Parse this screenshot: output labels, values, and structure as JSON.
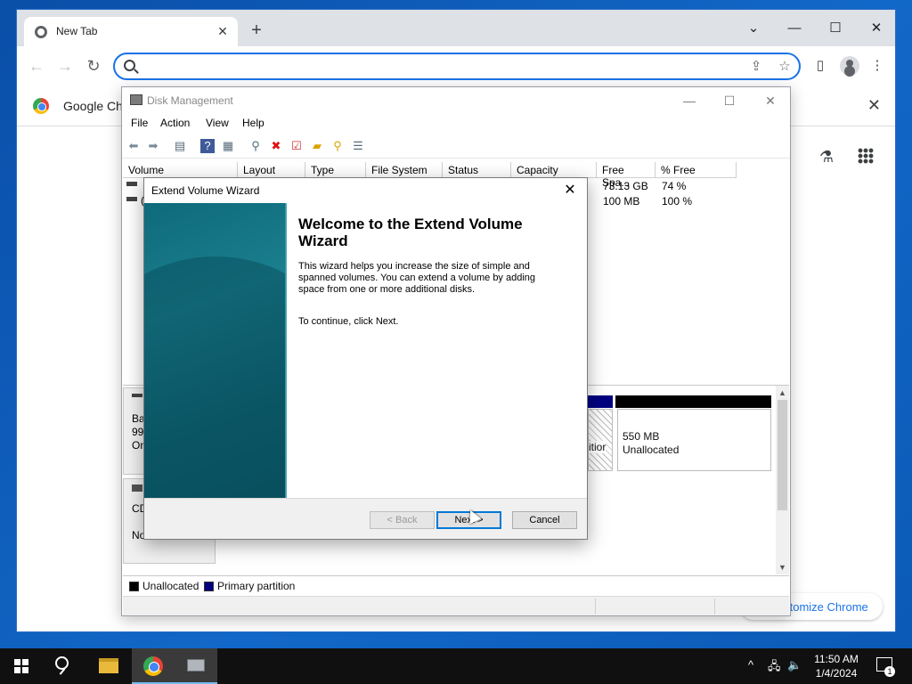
{
  "browser": {
    "tab_title": "New Tab",
    "tab_close": "✕",
    "new_tab": "+",
    "window_controls": {
      "menu": "⌄",
      "minimize": "—",
      "maximize": "☐",
      "close": "✕"
    },
    "nav": {
      "back": "←",
      "forward": "→",
      "reload": "↻"
    },
    "omnibox_placeholder": "",
    "share_icon": "⇪",
    "star_icon": "☆",
    "sidepanel_icon": "▯",
    "menu_icon": "⋮",
    "infobar_text": "Google Chr",
    "infobar_close": "✕",
    "labs_icon": "⚗",
    "customize_label": "ıtomize Chrome"
  },
  "disk_management": {
    "title": "Disk Management",
    "controls": {
      "minimize": "—",
      "maximize": "☐",
      "close": "✕"
    },
    "menu": [
      "File",
      "Action",
      "View",
      "Help"
    ],
    "toolbar_icons": [
      "back-arrow",
      "forward-arrow",
      "console-tree",
      "help",
      "properties",
      "connect",
      "delete",
      "check",
      "folder-up",
      "search",
      "list-view"
    ],
    "columns": [
      "Volume",
      "Layout",
      "Type",
      "File System",
      "Status",
      "Capacity",
      "Free Spa...",
      "% Free"
    ],
    "rows": [
      {
        "volume": "",
        "free_space": "73.13 GB",
        "pct_free": "74 %"
      },
      {
        "volume": "(",
        "free_space": "100 MB",
        "pct_free": "100 %"
      }
    ],
    "disks": [
      {
        "line1": "Ba",
        "line2": "99.",
        "line3": "On"
      },
      {
        "line1": "CD",
        "line2": "",
        "line3": "No"
      }
    ],
    "partitions": [
      {
        "label": "itior"
      },
      {
        "size": "550 MB",
        "status": "Unallocated"
      }
    ],
    "legend": [
      {
        "label": "Unallocated",
        "color": "#000000"
      },
      {
        "label": "Primary partition",
        "color": "#000080"
      }
    ]
  },
  "wizard": {
    "title": "Extend Volume Wizard",
    "close": "✕",
    "heading": "Welcome to the Extend Volume Wizard",
    "description": "This wizard helps you increase the size of simple and spanned volumes. You can extend a volume  by adding space from one or more additional disks.",
    "continue_text": "To continue, click Next.",
    "buttons": {
      "back": "< Back",
      "next": "Next >",
      "cancel": "Cancel"
    }
  },
  "taskbar": {
    "tray_chevron": "^",
    "clock_time": "11:50 AM",
    "clock_date": "1/4/2024",
    "notification_count": "1"
  }
}
